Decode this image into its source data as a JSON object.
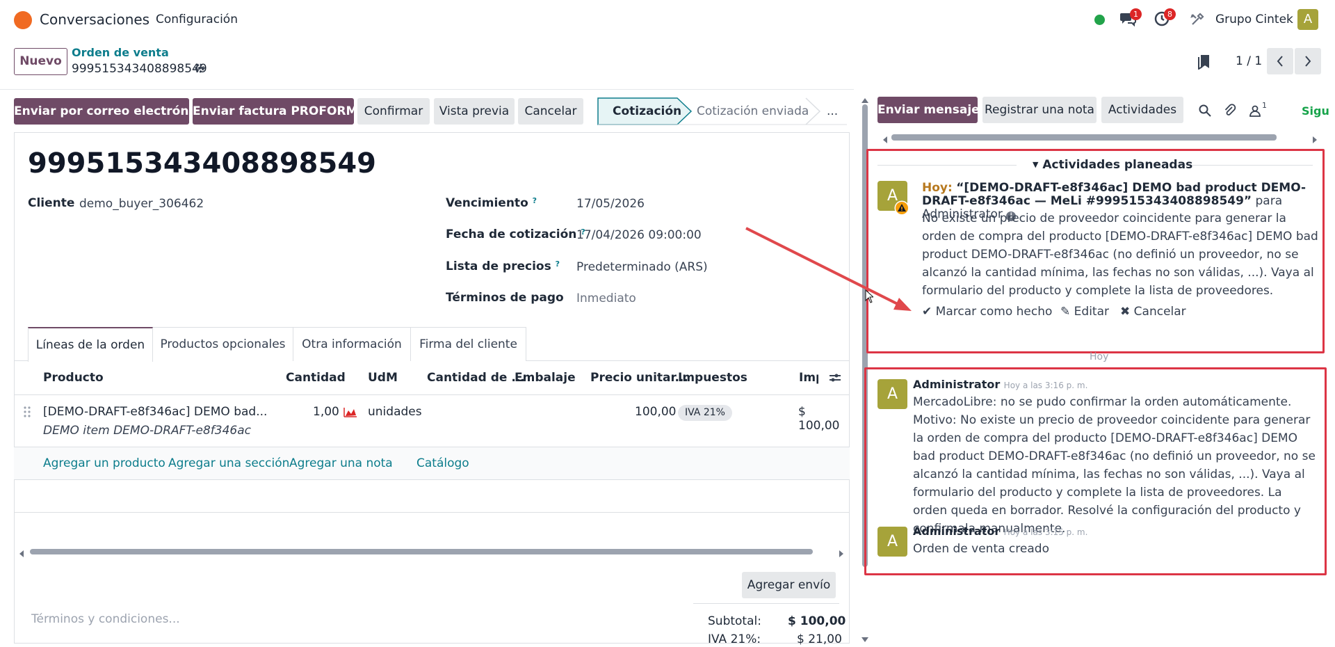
{
  "nav": {
    "app_title": "Conversaciones",
    "menu": "Configuración",
    "messages_badge": "1",
    "activities_badge": "8",
    "company": "Grupo Cintek",
    "user_initial": "A"
  },
  "control": {
    "new_button": "Nuevo",
    "breadcrumb_parent": "Orden de venta",
    "record_name": "999515343408898549",
    "pager": "1 / 1"
  },
  "actions": {
    "send_email": "Enviar por correo electrónico",
    "send_proforma": "Enviar factura PROFORMA",
    "confirm": "Confirmar",
    "preview": "Vista previa",
    "cancel": "Cancelar"
  },
  "statusbar": {
    "stages": [
      "Cotización",
      "Cotización enviada",
      "..."
    ],
    "current": "Cotización"
  },
  "form": {
    "title": "999515343408898549",
    "customer_label": "Cliente",
    "customer": "demo_buyer_306462",
    "expiration_label": "Vencimiento",
    "expiration": "17/05/2026",
    "quote_date_label": "Fecha de cotización",
    "quote_date": "17/04/2026 09:00:00",
    "pricelist_label": "Lista de precios",
    "pricelist": "Predeterminado (ARS)",
    "terms_label": "Términos de pago",
    "terms": "Inmediato",
    "help_mark": "?"
  },
  "tabs": [
    "Líneas de la orden",
    "Productos opcionales",
    "Otra información",
    "Firma del cliente"
  ],
  "table": {
    "headers": [
      "Producto",
      "Cantidad",
      "UdM",
      "Cantidad de ...",
      "Embalaje",
      "Precio unitar...",
      "Impuestos",
      "Impo"
    ],
    "rows": [
      {
        "product": "[DEMO-DRAFT-e8f346ac] DEMO bad...",
        "description": "DEMO item DEMO-DRAFT-e8f346ac",
        "quantity": "1,00",
        "uom": "unidades",
        "price": "100,00",
        "tax": "IVA 21%",
        "amount": "$ 100,00"
      }
    ],
    "add_product": "Agregar un producto",
    "add_section": "Agregar una sección",
    "add_note": "Agregar una nota",
    "catalog": "Catálogo"
  },
  "footer": {
    "add_shipping": "Agregar envío",
    "terms_placeholder": "Términos y condiciones...",
    "subtotal_label": "Subtotal:",
    "subtotal": "$ 100,00",
    "tax_label": "IVA 21%:",
    "tax": "$ 21,00"
  },
  "chatter": {
    "send_message": "Enviar mensaje",
    "log_note": "Registrar una nota",
    "activities": "Actividades",
    "followers_count": "1",
    "follow": "Sigu",
    "planned_header": "Actividades planeadas",
    "activity": {
      "when": "Hoy:",
      "summary": "“[DEMO-DRAFT-e8f346ac] DEMO bad product DEMO-DRAFT-e8f346ac — MeLi #999515343408898549”",
      "assignee": "para Administrator",
      "body": "No existe un precio de proveedor coincidente para generar la orden de compra del producto [DEMO-DRAFT-e8f346ac] DEMO bad product DEMO-DRAFT-e8f346ac (no definió un proveedor, no se alcanzó la cantidad mínima, las fechas no son válidas, ...). Vaya al formulario del producto y complete la lista de proveedores.",
      "mark_done": "Marcar como hecho",
      "edit": "Editar",
      "cancel": "Cancelar",
      "avatar": "A"
    },
    "day_separator": "Hoy",
    "messages": [
      {
        "author": "Administrator",
        "time": "Hoy a las 3:16 p. m.",
        "body": "MercadoLibre: no se pudo confirmar la orden automáticamente. Motivo: No existe un precio de proveedor coincidente para generar la orden de compra del producto [DEMO-DRAFT-e8f346ac] DEMO bad product DEMO-DRAFT-e8f346ac (no definió un proveedor, no se alcanzó la cantidad mínima, las fechas no son válidas, ...). Vaya al formulario del producto y complete la lista de proveedores. La orden queda en borrador. Resolvé la configuración del producto y confirmala manualmente.",
        "avatar": "A"
      },
      {
        "author": "Administrator",
        "time": "Hoy a las 3:15 p. m.",
        "body": "Orden de venta creado",
        "avatar": "A"
      }
    ]
  },
  "colors": {
    "brand": "#6f4a66",
    "link": "#0d7d8c",
    "highlight": "#dc3545",
    "arrow": "#e0484c"
  }
}
